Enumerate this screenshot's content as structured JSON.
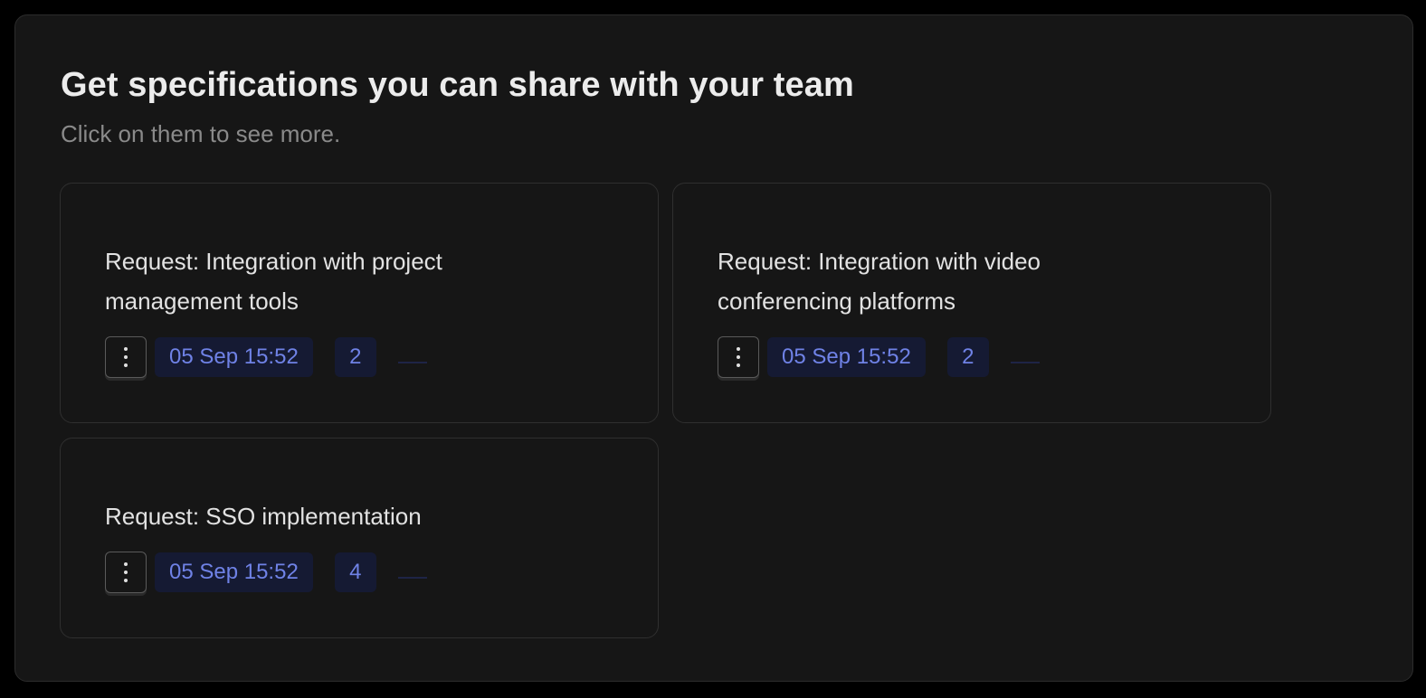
{
  "header": {
    "title": "Get specifications you can share with your team",
    "subtitle": "Click on them to see more."
  },
  "cards": [
    {
      "title": "Request: Integration with project management tools",
      "date": "05 Sep 15:52",
      "count": "2",
      "menu_icon": "vertical-dots-icon"
    },
    {
      "title": "Request: Integration with video conferencing platforms",
      "date": "05 Sep 15:52",
      "count": "2",
      "menu_icon": "vertical-dots-icon"
    },
    {
      "title": "Request: SSO implementation",
      "date": "05 Sep 15:52",
      "count": "4",
      "menu_icon": "vertical-dots-icon"
    }
  ],
  "colors": {
    "background": "#000000",
    "panel": "#161616",
    "badge_bg": "#151a33",
    "badge_text": "#6f82e6"
  }
}
